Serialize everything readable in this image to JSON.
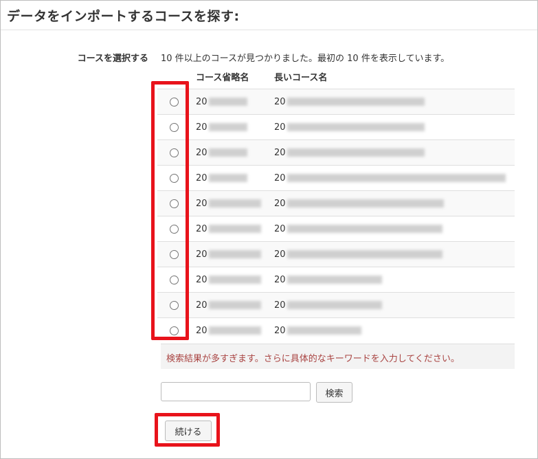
{
  "page": {
    "title": "データをインポートするコースを探す:"
  },
  "course_select": {
    "label": "コースを選択する",
    "result_summary": "10 件以上のコースが見つかりました。最初の 10 件を表示しています。",
    "columns": {
      "short_name": "コース省略名",
      "long_name": "長いコース名"
    },
    "rows": [
      {
        "short_prefix": "20",
        "long_prefix": "20"
      },
      {
        "short_prefix": "20",
        "long_prefix": "20"
      },
      {
        "short_prefix": "20",
        "long_prefix": "20"
      },
      {
        "short_prefix": "20",
        "long_prefix": "20"
      },
      {
        "short_prefix": "20",
        "long_prefix": "20"
      },
      {
        "short_prefix": "20",
        "long_prefix": "20"
      },
      {
        "short_prefix": "20",
        "long_prefix": "20"
      },
      {
        "short_prefix": "20",
        "long_prefix": "20"
      },
      {
        "short_prefix": "20",
        "long_prefix": "20"
      },
      {
        "short_prefix": "20",
        "long_prefix": "20"
      }
    ]
  },
  "warning": {
    "text": "検索結果が多すぎます。さらに具体的なキーワードを入力してください。"
  },
  "search": {
    "input_value": "",
    "button_label": "検索"
  },
  "actions": {
    "continue_label": "続ける"
  },
  "colors": {
    "highlight": "#e8131b",
    "warning_text": "#a94442"
  }
}
